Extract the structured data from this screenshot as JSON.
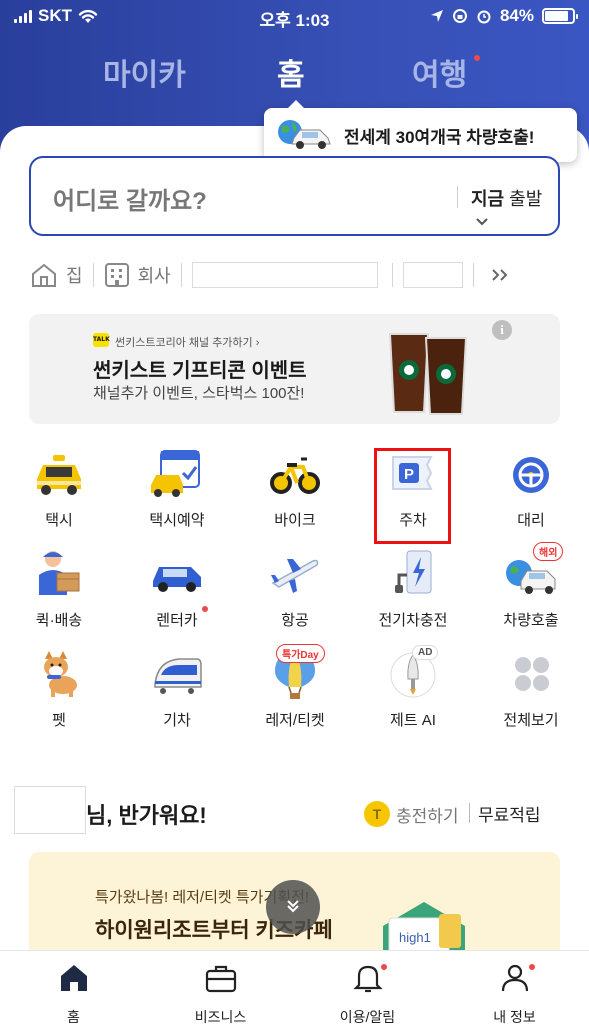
{
  "status_bar": {
    "carrier": "SKT",
    "time": "오후 1:03",
    "battery": "84%",
    "battery_level": 0.84
  },
  "top_tabs": [
    {
      "label": "마이카",
      "active": false
    },
    {
      "label": "홈",
      "active": true
    },
    {
      "label": "여행",
      "active": false,
      "badge": true
    }
  ],
  "tooltip": {
    "text": "전세계 30여개국 차량호출!",
    "icon": "globe-car-icon"
  },
  "search": {
    "placeholder": "어디로 갈까요?",
    "depart_bold": "지금",
    "depart_label": "출발"
  },
  "shortcuts": [
    {
      "label": "집",
      "icon": "home-icon"
    },
    {
      "label": "회사",
      "icon": "building-icon"
    }
  ],
  "banner": {
    "channel": "썬키스트코리아 채널 추가하기 ›",
    "title": "썬키스트 기프티콘 이벤트",
    "description": "채널추가 이벤트, 스타벅스 100잔!",
    "kakao_badge": "TALK"
  },
  "services": [
    {
      "label": "택시",
      "icon": "taxi-icon"
    },
    {
      "label": "택시예약",
      "icon": "taxi-reservation-icon"
    },
    {
      "label": "바이크",
      "icon": "bike-icon"
    },
    {
      "label": "주차",
      "icon": "parking-icon"
    },
    {
      "label": "대리",
      "icon": "designated-driver-icon"
    },
    {
      "label": "퀵·배송",
      "icon": "delivery-icon"
    },
    {
      "label": "렌터카",
      "icon": "rental-car-icon",
      "dot": true
    },
    {
      "label": "항공",
      "icon": "airplane-icon"
    },
    {
      "label": "전기차충전",
      "icon": "ev-charger-icon"
    },
    {
      "label": "차량호출",
      "icon": "global-car-icon",
      "tag": "해외"
    },
    {
      "label": "펫",
      "icon": "pet-icon"
    },
    {
      "label": "기차",
      "icon": "train-icon"
    },
    {
      "label": "레저/티켓",
      "icon": "balloon-icon",
      "tag": "특가Day"
    },
    {
      "label": "제트 AI",
      "icon": "rocket-icon",
      "tag": "AD"
    },
    {
      "label": "전체보기",
      "icon": "grid-icon"
    }
  ],
  "greeting": {
    "text": "님, 반가워요!",
    "charge_label": "충전하기",
    "coin": "T",
    "free_label": "무료적립"
  },
  "promo": {
    "line1": "특가왔나봄! 레저/티켓 특가기획전!",
    "line2": "하이원리조트부터 키즈카페",
    "brand": "high1"
  },
  "bottom_nav": [
    {
      "label": "홈",
      "icon": "home-filled-icon"
    },
    {
      "label": "비즈니스",
      "icon": "briefcase-icon"
    },
    {
      "label": "이용/알림",
      "icon": "bell-icon",
      "dot": true
    },
    {
      "label": "내 정보",
      "icon": "person-icon",
      "dot": true
    }
  ],
  "colors": {
    "brand_blue": "#2b47b3",
    "accent_red": "#e11111",
    "promo_bg": "#fdf3d6"
  }
}
